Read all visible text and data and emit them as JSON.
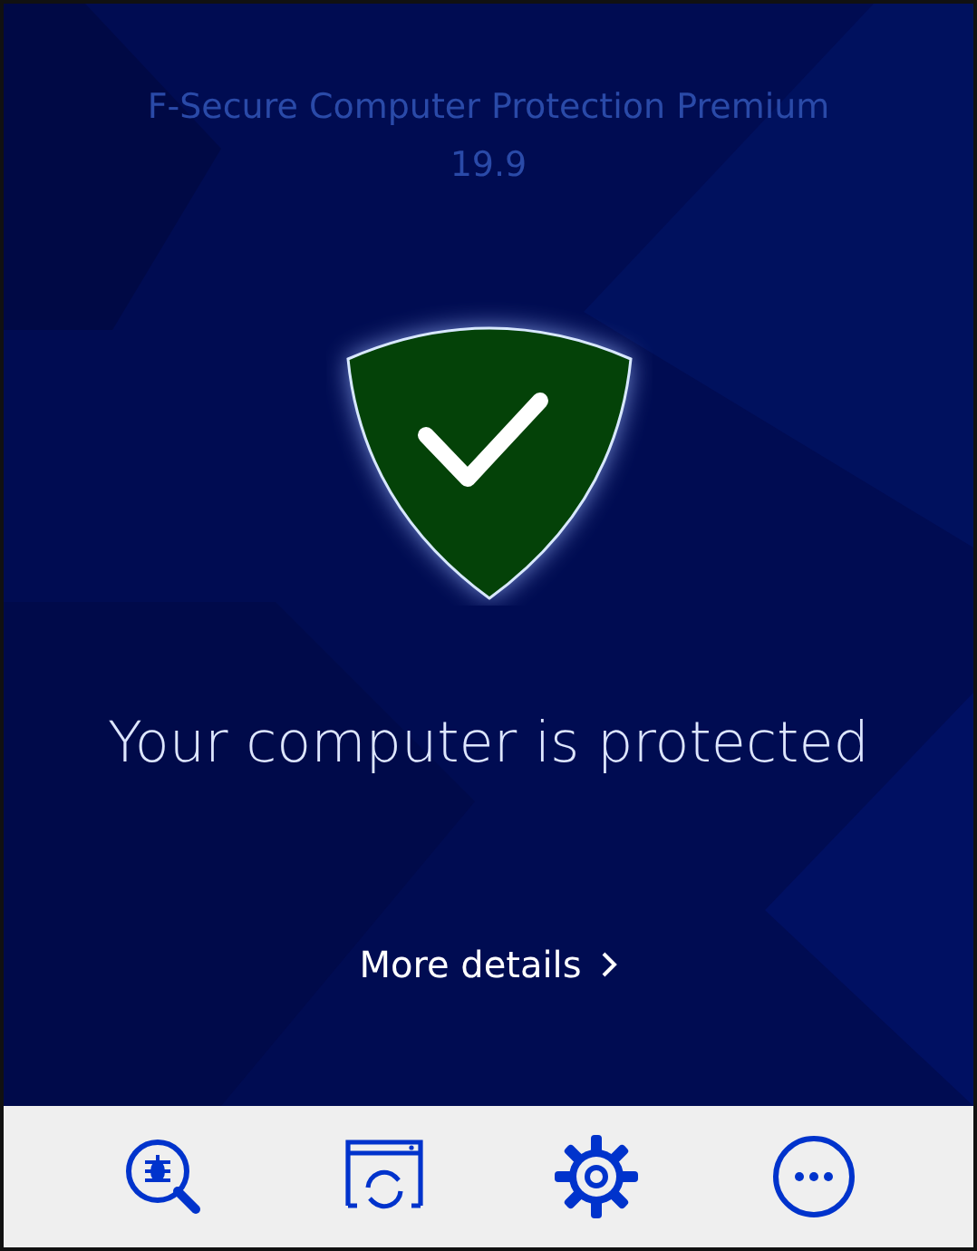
{
  "header": {
    "title": "F-Secure Computer Protection Premium",
    "version": "19.9"
  },
  "status": {
    "text": "Your computer is protected",
    "protected": true
  },
  "details_link": {
    "label": "More details"
  },
  "toolbar": [
    {
      "kind": "scan"
    },
    {
      "kind": "update"
    },
    {
      "kind": "settings"
    },
    {
      "kind": "more"
    }
  ]
}
